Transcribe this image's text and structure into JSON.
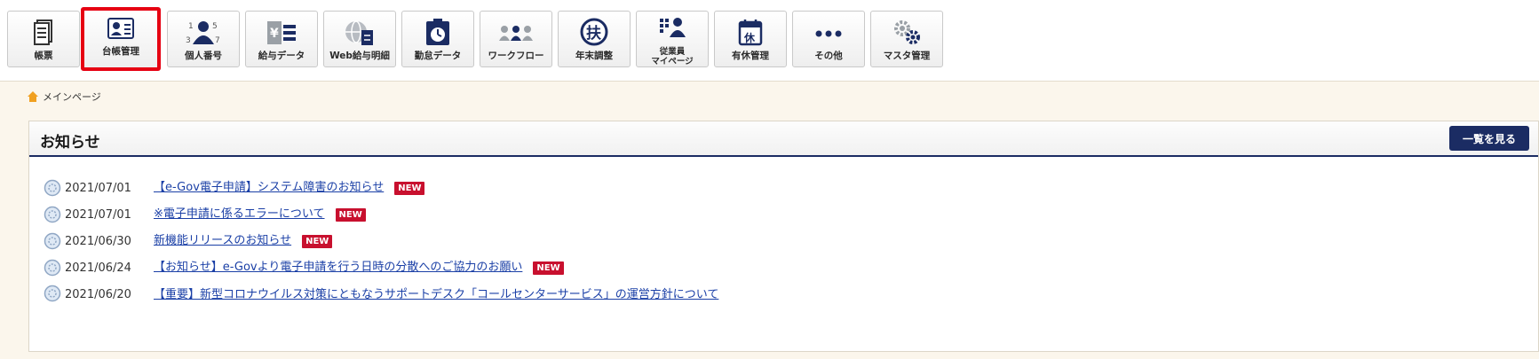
{
  "toolbar": {
    "items": [
      {
        "label": "帳票",
        "icon": "document-list-icon"
      },
      {
        "label": "台帳管理",
        "icon": "ledger-card-icon",
        "active": true
      },
      {
        "label": "個人番号",
        "icon": "person-number-icon"
      },
      {
        "label": "給与データ",
        "icon": "yen-list-icon"
      },
      {
        "label": "Web給与明細",
        "icon": "globe-document-icon"
      },
      {
        "label": "勤怠データ",
        "icon": "attendance-clock-icon"
      },
      {
        "label": "ワークフロー",
        "icon": "workflow-people-icon"
      },
      {
        "label": "年末調整",
        "icon": "fu-circle-icon"
      },
      {
        "label": "従業員",
        "label2": "マイページ",
        "icon": "employee-mypage-icon"
      },
      {
        "label": "有休管理",
        "icon": "leave-calendar-icon"
      },
      {
        "label": "その他",
        "icon": "more-dots-icon"
      },
      {
        "label": "マスタ管理",
        "icon": "gears-icon"
      }
    ]
  },
  "breadcrumb": {
    "home_label": "メインページ"
  },
  "notices": {
    "title": "お知らせ",
    "view_all_label": "一覧を見る",
    "badge_label": "NEW",
    "items": [
      {
        "date": "2021/07/01",
        "text": "【e-Gov電子申請】システム障害のお知らせ",
        "is_new": true
      },
      {
        "date": "2021/07/01",
        "text": "※電子申請に係るエラーについて",
        "is_new": true
      },
      {
        "date": "2021/06/30",
        "text": "新機能リリースのお知らせ",
        "is_new": true
      },
      {
        "date": "2021/06/24",
        "text": "【お知らせ】e-Govより電子申請を行う日時の分散へのご協力のお願い",
        "is_new": true
      },
      {
        "date": "2021/06/20",
        "text": "【重要】新型コロナウイルス対策にともなうサポートデスク「コールセンターサービス」の運営方針について",
        "is_new": false
      }
    ]
  },
  "colors": {
    "accent": "#1b2c63",
    "active_border": "#e60012",
    "new_badge": "#c8102e",
    "link": "#1a3fa6",
    "background": "#fbf6ec",
    "home_icon": "#f0a020"
  }
}
